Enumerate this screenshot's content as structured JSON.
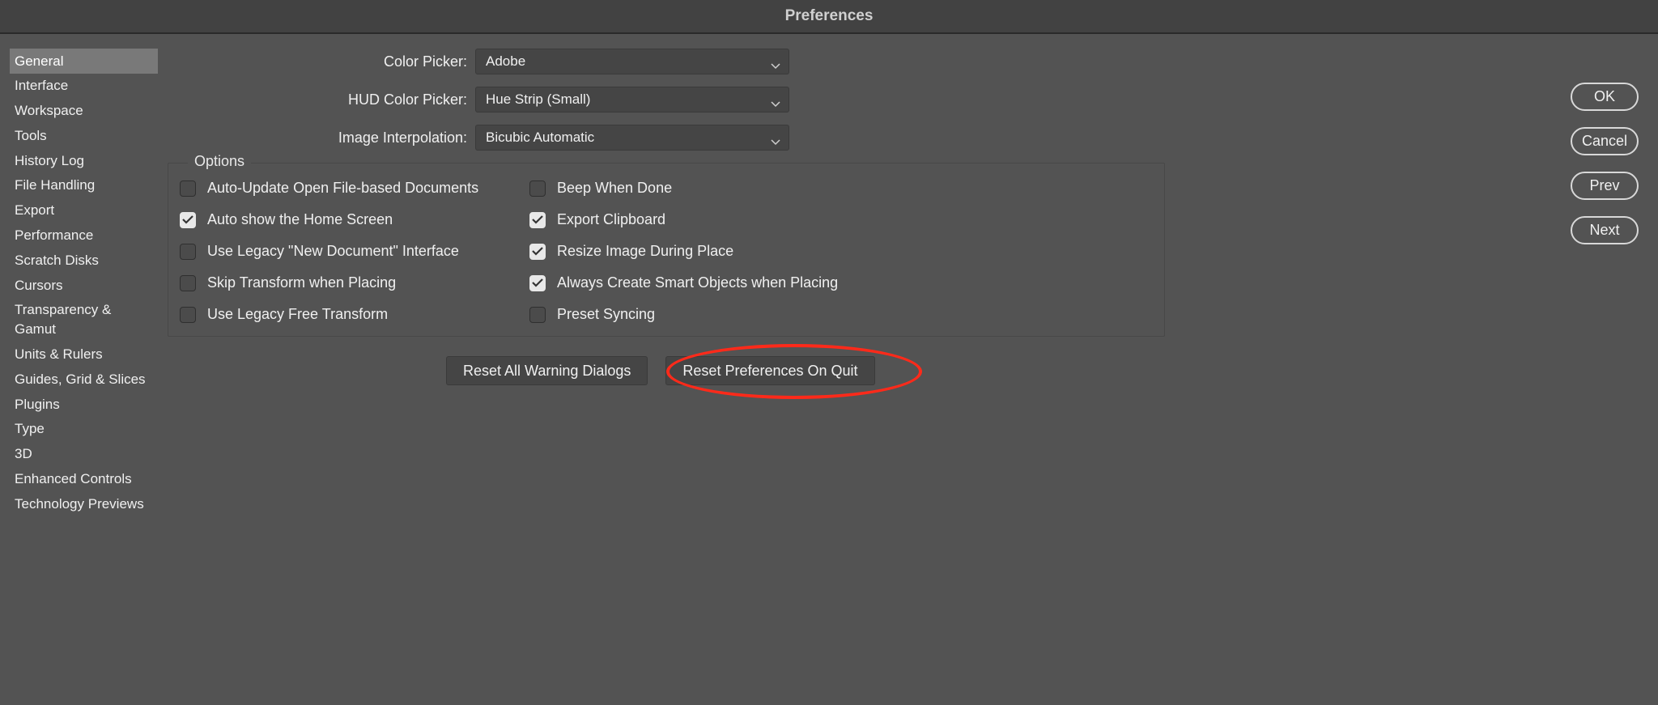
{
  "title": "Preferences",
  "sidebar": {
    "items": [
      {
        "label": "General",
        "selected": true
      },
      {
        "label": "Interface"
      },
      {
        "label": "Workspace"
      },
      {
        "label": "Tools"
      },
      {
        "label": "History Log"
      },
      {
        "label": "File Handling"
      },
      {
        "label": "Export"
      },
      {
        "label": "Performance"
      },
      {
        "label": "Scratch Disks"
      },
      {
        "label": "Cursors"
      },
      {
        "label": "Transparency & Gamut"
      },
      {
        "label": "Units & Rulers"
      },
      {
        "label": "Guides, Grid & Slices"
      },
      {
        "label": "Plugins"
      },
      {
        "label": "Type"
      },
      {
        "label": "3D"
      },
      {
        "label": "Enhanced Controls"
      },
      {
        "label": "Technology Previews"
      }
    ]
  },
  "form": {
    "color_picker": {
      "label": "Color Picker:",
      "value": "Adobe"
    },
    "hud_color_picker": {
      "label": "HUD Color Picker:",
      "value": "Hue Strip (Small)"
    },
    "image_interpolation": {
      "label": "Image Interpolation:",
      "value": "Bicubic Automatic"
    }
  },
  "options_legend": "Options",
  "options_left": [
    {
      "label": "Auto-Update Open File-based Documents",
      "checked": false
    },
    {
      "label": "Auto show the Home Screen",
      "checked": true
    },
    {
      "label": "Use Legacy \"New Document\" Interface",
      "checked": false
    },
    {
      "label": "Skip Transform when Placing",
      "checked": false
    },
    {
      "label": "Use Legacy Free Transform",
      "checked": false
    }
  ],
  "options_right": [
    {
      "label": "Beep When Done",
      "checked": false
    },
    {
      "label": "Export Clipboard",
      "checked": true
    },
    {
      "label": "Resize Image During Place",
      "checked": true
    },
    {
      "label": "Always Create Smart Objects when Placing",
      "checked": true
    },
    {
      "label": "Preset Syncing",
      "checked": false
    }
  ],
  "buttons": {
    "reset_warnings": "Reset All Warning Dialogs",
    "reset_prefs": "Reset Preferences On Quit",
    "ok": "OK",
    "cancel": "Cancel",
    "prev": "Prev",
    "next": "Next"
  }
}
